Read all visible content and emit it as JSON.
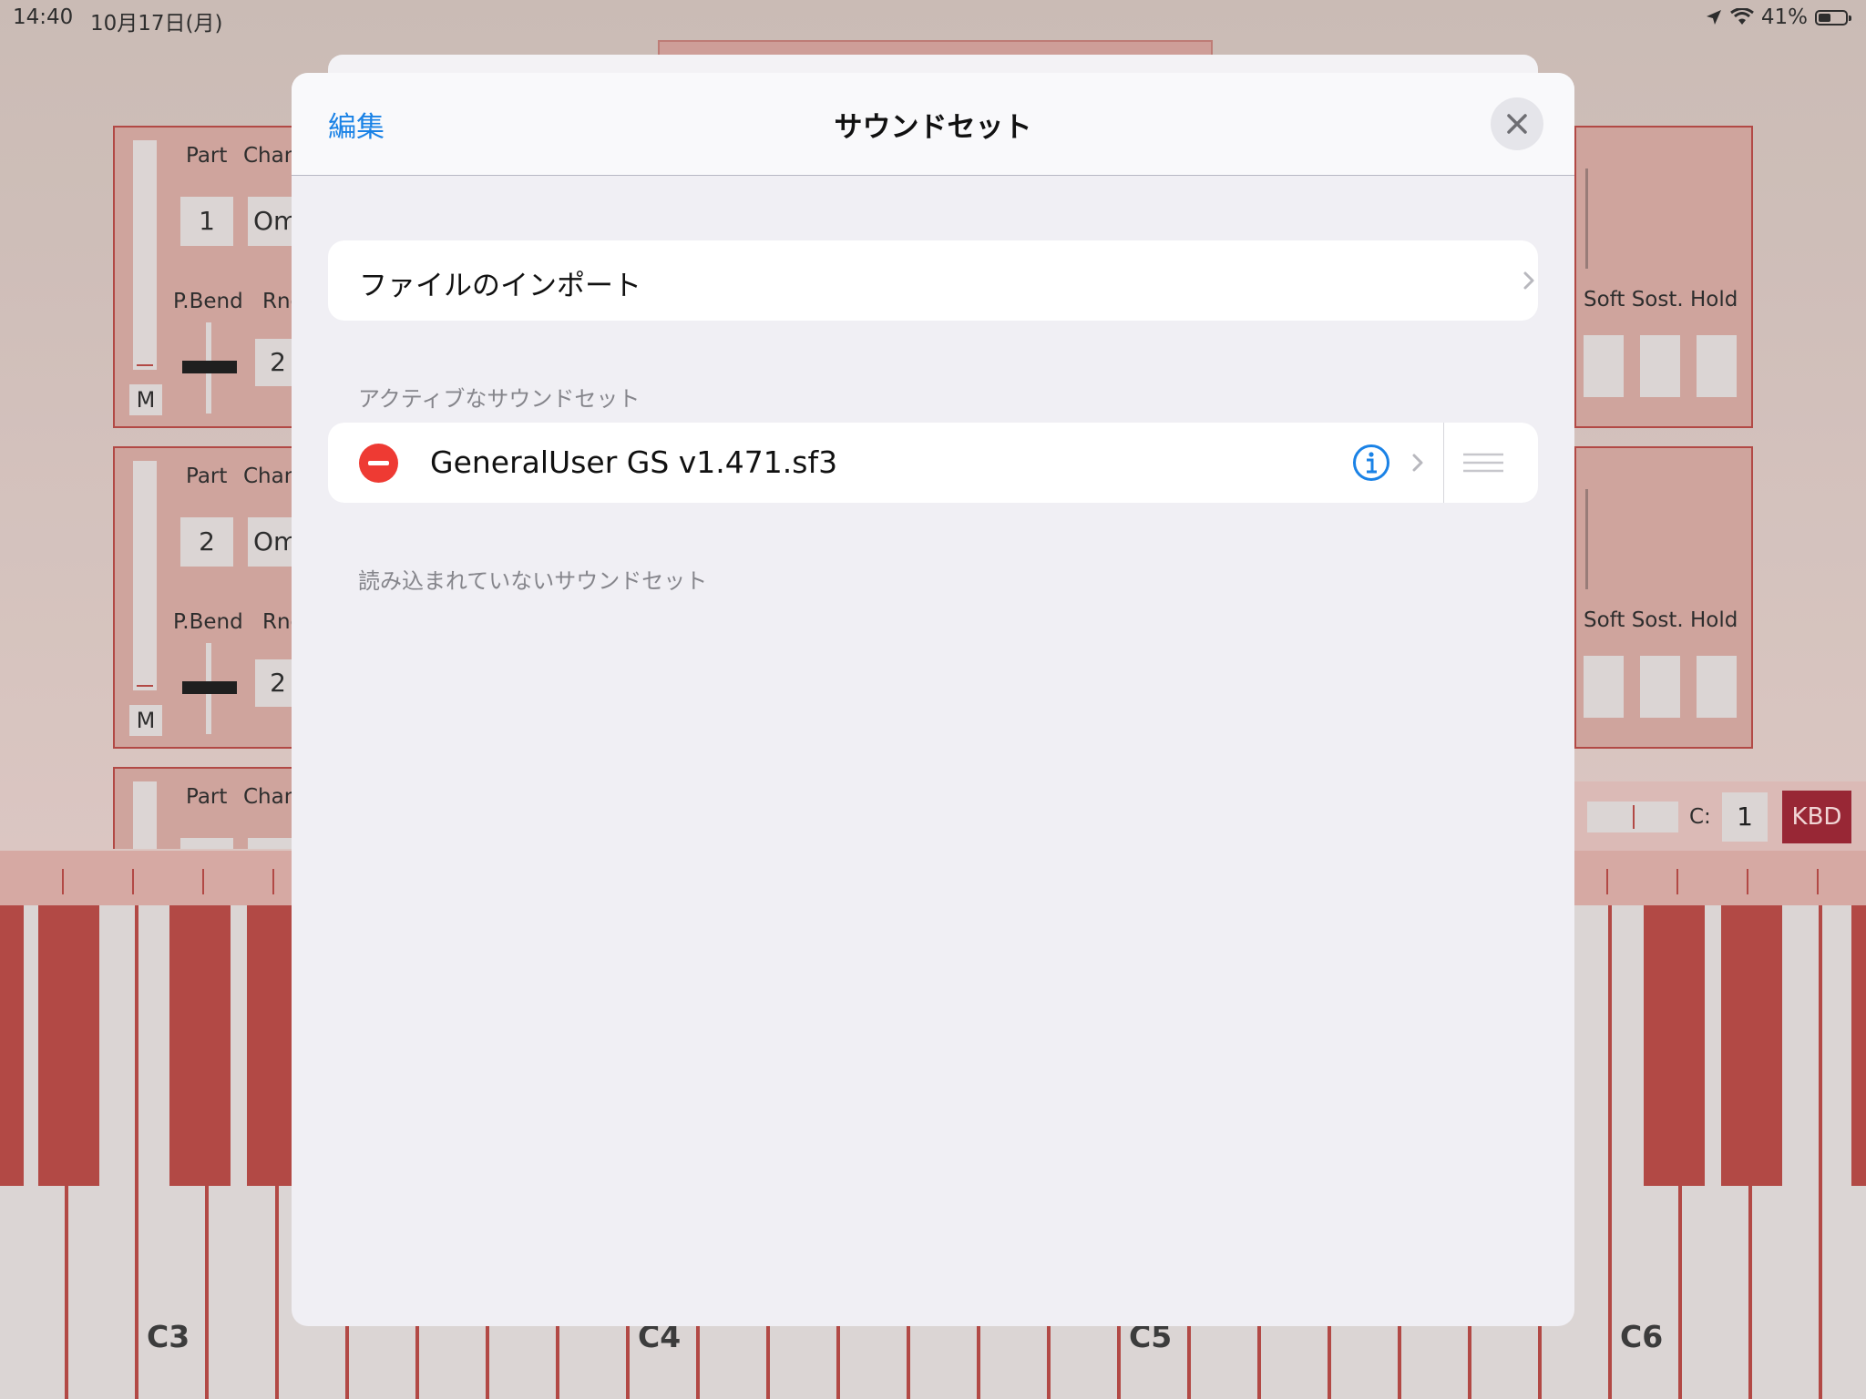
{
  "status": {
    "time": "14:40",
    "date": "10月17日(月)",
    "battery": "41%"
  },
  "bg": {
    "parts": [
      {
        "part": "Part",
        "chan": "Chan",
        "part_num": "1",
        "omni": "Om",
        "pbend": "P.Bend",
        "rng": "Rng",
        "rng_val": "2",
        "mute": "M"
      },
      {
        "part": "Part",
        "chan": "Chan",
        "part_num": "2",
        "omni": "Om",
        "pbend": "P.Bend",
        "rng": "Rng",
        "rng_val": "2",
        "mute": "M"
      },
      {
        "part": "Part",
        "chan": "Chan"
      }
    ],
    "pedals_label": "Soft Sost. Hold",
    "channel_label": "C:",
    "channel_value": "1",
    "kbd_button": "KBD",
    "notes": [
      "C3",
      "C4",
      "C5",
      "C6"
    ]
  },
  "modal": {
    "edit": "編集",
    "title": "サウンドセット",
    "import_label": "ファイルのインポート",
    "active_header": "アクティブなサウンドセット",
    "active_items": [
      {
        "name": "GeneralUser GS v1.471.sf3"
      }
    ],
    "inactive_header": "読み込まれていないサウンドセット"
  }
}
